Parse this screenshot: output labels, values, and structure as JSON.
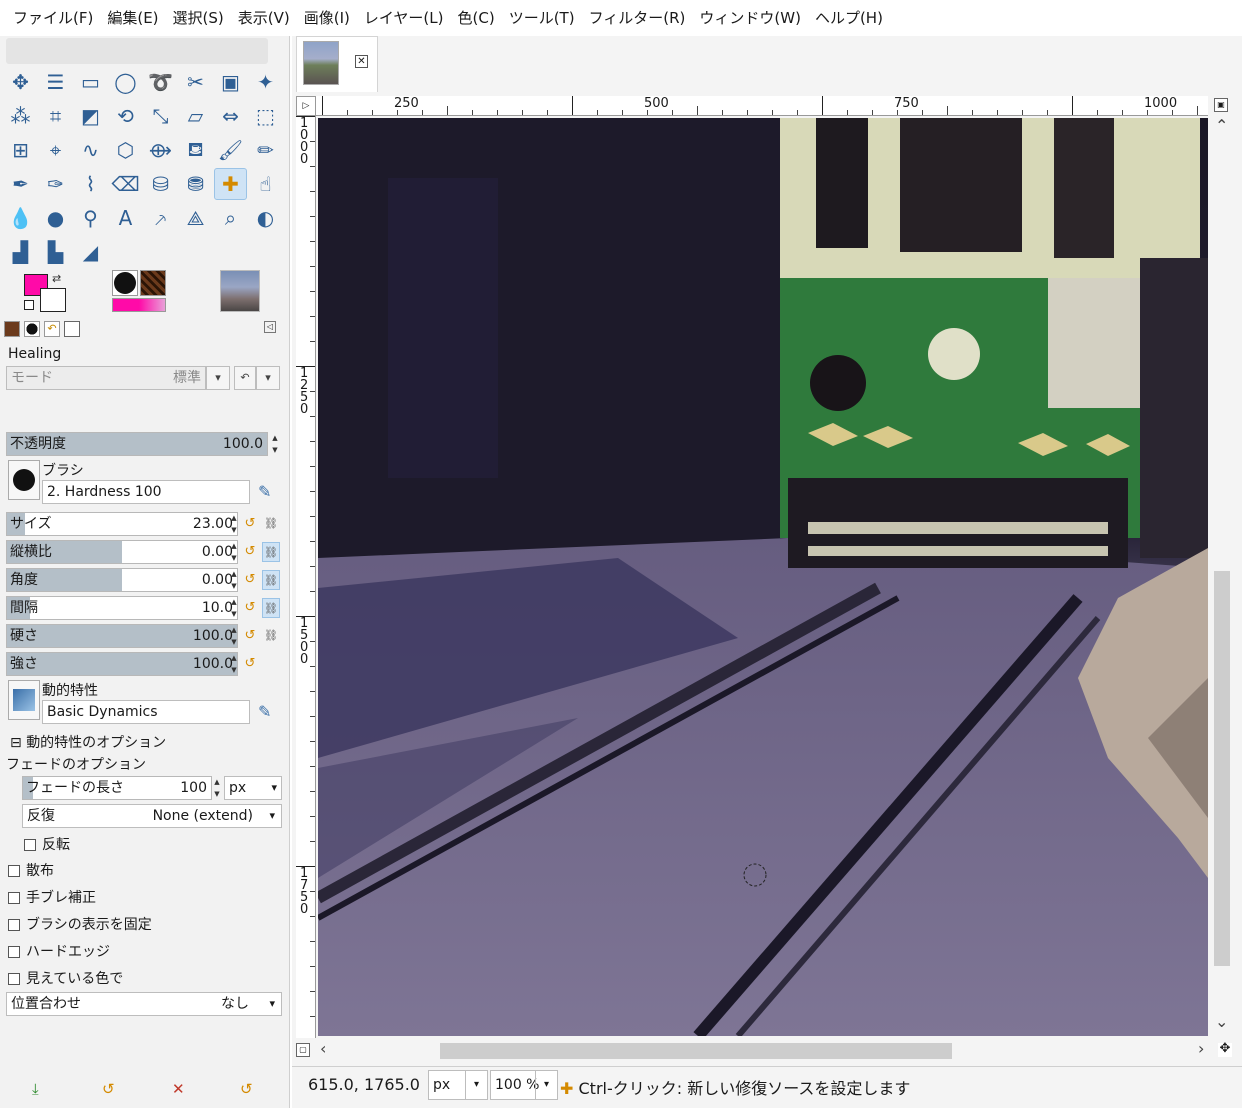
{
  "menubar": {
    "items": [
      "ファイル(F)",
      "編集(E)",
      "選択(S)",
      "表示(V)",
      "画像(I)",
      "レイヤー(L)",
      "色(C)",
      "ツール(T)",
      "フィルター(R)",
      "ウィンドウ(W)",
      "ヘルプ(H)"
    ]
  },
  "toolbox": {
    "tools": [
      "move-tool-icon",
      "align-tool-icon",
      "rect-select-icon",
      "ellipse-select-icon",
      "free-select-icon",
      "scissors-select-icon",
      "foreground-select-icon",
      "fuzzy-select-icon",
      "color-select-icon",
      "crop-tool-icon",
      "unified-transform-icon",
      "rotate-tool-icon",
      "scale-tool-icon",
      "shear-tool-icon",
      "flip-tool-icon",
      "perspective-tool-icon",
      "3d-transform-icon",
      "handle-transform-icon",
      "warp-transform-icon",
      "cage-transform-icon",
      "wrap-icon",
      "paint-bucket-icon",
      "paintbrush-icon",
      "pencil-icon",
      "airbrush-icon",
      "ink-icon",
      "mypaint-brush-icon",
      "eraser-icon",
      "clone-icon",
      "perspective-clone-icon",
      "heal-icon",
      "smudge-icon",
      "blur-icon",
      "dodge-burn-icon",
      "paths-icon",
      "text-tool-icon",
      "color-picker-icon",
      "measure-icon",
      "zoom-icon",
      "gegl-icon",
      "levels-icon",
      "curves-icon",
      "gradient-icon"
    ],
    "colors": {
      "foreground": "#ff0aa8",
      "background": "#ffffff"
    }
  },
  "tool_options": {
    "title": "Healing",
    "mode": {
      "label": "モード",
      "value": "標準"
    },
    "opacity": {
      "label": "不透明度",
      "value": "100.0",
      "fraction": 1.0
    },
    "brush": {
      "label": "ブラシ",
      "value": "2. Hardness 100"
    },
    "size": {
      "label": "サイズ",
      "value": "23.00",
      "fraction": 0.08
    },
    "aspect": {
      "label": "縦横比",
      "value": "0.00",
      "fraction": 0.5
    },
    "angle": {
      "label": "角度",
      "value": "0.00",
      "fraction": 0.5
    },
    "spacing": {
      "label": "間隔",
      "value": "10.0",
      "fraction": 0.1
    },
    "hardness": {
      "label": "硬さ",
      "value": "100.0",
      "fraction": 1.0
    },
    "force": {
      "label": "強さ",
      "value": "100.0",
      "fraction": 1.0
    },
    "dynamics": {
      "label": "動的特性",
      "value": "Basic Dynamics"
    },
    "dynamics_options": "動的特性のオプション",
    "fade_options": "フェードのオプション",
    "fade_length": {
      "label": "フェードの長さ",
      "value": "100",
      "unit": "px"
    },
    "repeat": {
      "label": "反復",
      "value": "None (extend)"
    },
    "reverse": "反転",
    "checkboxes": [
      "散布",
      "手ブレ補正",
      "ブラシの表示を固定",
      "ハードエッジ",
      "見えている色で"
    ],
    "alignment": {
      "label": "位置合わせ",
      "value": "なし"
    }
  },
  "rulers": {
    "h_labels": [
      "250",
      "500",
      "750",
      "1000"
    ],
    "v_labels": [
      "1000",
      "1250",
      "1500",
      "1750"
    ]
  },
  "statusbar": {
    "coords": "615.0, 1765.0",
    "unit": "px",
    "zoom": "100 %",
    "message": "Ctrl-クリック: 新しい修復ソースを設定します"
  }
}
